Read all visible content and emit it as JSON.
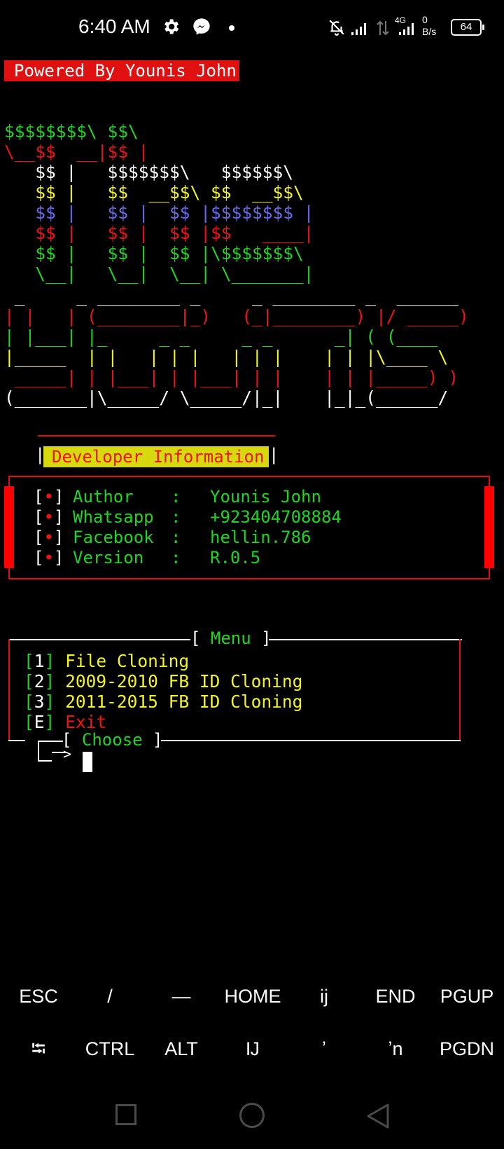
{
  "status_bar": {
    "time": "6:40 AM",
    "network_type": "4G",
    "net_speed_value": "0",
    "net_speed_unit": "B/s",
    "battery": "64",
    "icons": [
      "gear-icon",
      "messenger-icon",
      "bell-off-icon",
      "signal-icon",
      "data-arrows-icon",
      "signal-icon"
    ]
  },
  "powered_by": "Powered By Younis John",
  "banner": {
    "lines_1": [
      [
        {
          "t": "$$$$$$$$\\ $$\\",
          "c": "g"
        }
      ],
      [
        {
          "t": "\\__$$  __|$$ |",
          "c": "r"
        }
      ],
      [
        {
          "t": "   $$ |   $$$$$$$\\   $$$$$$\\",
          "c": "w"
        }
      ],
      [
        {
          "t": "   $$ |   $$  __$$\\ $$  __$$\\",
          "c": "y"
        }
      ],
      [
        {
          "t": "   $$ |   $$ |  $$ |$$$$$$$$ |",
          "c": "b"
        }
      ],
      [
        {
          "t": "   $$ |   $$ |  $$ |$$   ____|",
          "c": "r"
        }
      ],
      [
        {
          "t": "   $$ |   $$ |  $$ |\\$$$$$$$\\",
          "c": "g"
        }
      ],
      [
        {
          "t": "   \\__|   \\__|  \\__| \\_______|",
          "c": "g"
        }
      ]
    ],
    "lines_2": [
      [
        {
          "t": " _     _ ________ _     _ ________ _  ______",
          "c": "w"
        }
      ],
      [
        {
          "t": "| |   | (________|_)   (_|________) |/ _____)",
          "c": "r"
        }
      ],
      [
        {
          "t": "| |___| |_     _ _     _ _      _| ( (____",
          "c": "g"
        }
      ],
      [
        {
          "t": "|_____  | |   | | |   | | |    | | |\\____ \\",
          "c": "y"
        }
      ],
      [
        {
          "t": " _____| | |___| | |___| | |    | | |_____) )",
          "c": "r"
        }
      ],
      [
        {
          "t": "(_______|\\_____/ \\_____/|_|    |_|_(______/",
          "c": "w"
        }
      ]
    ]
  },
  "developer_info": {
    "title": "Developer Information",
    "bullet": "•",
    "rows": [
      {
        "label": "Author",
        "value": "Younis John"
      },
      {
        "label": "Whatsapp",
        "value": "+923404708884"
      },
      {
        "label": "Facebook",
        "value": "hellin.786"
      },
      {
        "label": "Version",
        "value": "R.0.5"
      }
    ]
  },
  "menu": {
    "title": "Menu",
    "items": [
      {
        "key": "1",
        "label": "File Cloning"
      },
      {
        "key": "2",
        "label": "2009-2010 FB ID Cloning"
      },
      {
        "key": "3",
        "label": "2011-2015 FB ID Cloning"
      },
      {
        "key": "E",
        "label": "Exit"
      }
    ],
    "prompt_label": "Choose"
  },
  "extra_keys": {
    "row1": [
      "ESC",
      "/",
      "—",
      "HOME",
      "ij",
      "END",
      "PGUP"
    ],
    "row2": [
      "⭾",
      "CTRL",
      "ALT",
      "Ĳ",
      "ʼ",
      "ʼn",
      "PGDN"
    ]
  },
  "colors": {
    "background": "#000000",
    "green": "#22d422",
    "red": "#ee1414",
    "yellow": "#f5f51e",
    "blue": "#6a6ae8",
    "white": "#ffffff"
  }
}
